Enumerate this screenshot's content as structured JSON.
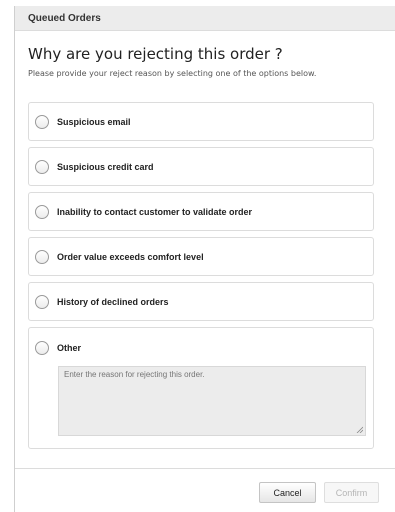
{
  "dialog": {
    "title": "Queued Orders",
    "heading": "Why are you rejecting this order ?",
    "subtext": "Please provide your reject reason by selecting one of the options below."
  },
  "options": [
    {
      "label": "Suspicious email",
      "selected": false
    },
    {
      "label": "Suspicious credit card",
      "selected": false
    },
    {
      "label": "Inability to contact customer to validate order",
      "selected": false
    },
    {
      "label": "Order value exceeds comfort level",
      "selected": false
    },
    {
      "label": "History of declined orders",
      "selected": false
    },
    {
      "label": "Other",
      "selected": false
    }
  ],
  "reason": {
    "placeholder": "Enter the reason for rejecting this order.",
    "value": ""
  },
  "buttons": {
    "cancel": "Cancel",
    "confirm": "Confirm",
    "confirm_enabled": false
  },
  "colors": {
    "titlebar_bg": "#ececec",
    "textarea_bg": "#ececec",
    "disabled_text": "#b5b5b5"
  },
  "icons": [
    "radio-button-icon",
    "resize-grip-icon"
  ]
}
